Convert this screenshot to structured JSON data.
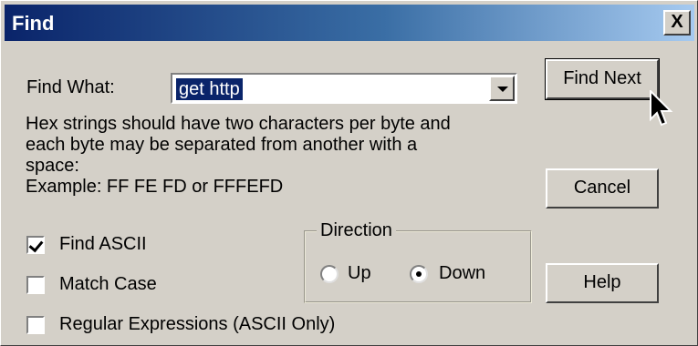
{
  "dialog": {
    "title": "Find",
    "close_label": "X"
  },
  "find_what": {
    "label": "Find What:",
    "value": "get http"
  },
  "description": [
    "Hex strings should have two characters per byte and",
    "each byte may be separated from another with a",
    "space:",
    "Example: FF FE FD  or FFFEFD"
  ],
  "buttons": {
    "find_next": "Find Next",
    "cancel": "Cancel",
    "help": "Help"
  },
  "options": {
    "find_ascii": {
      "label": "Find ASCII",
      "checked": true
    },
    "match_case": {
      "label": "Match Case",
      "checked": false
    },
    "regex": {
      "label": "Regular Expressions (ASCII Only)",
      "checked": false
    }
  },
  "direction": {
    "title": "Direction",
    "up": "Up",
    "down": "Down",
    "selected": "Down"
  },
  "icons": {
    "cursor": "mouse-pointer-icon",
    "dropdown": "dropdown-arrow-icon"
  }
}
